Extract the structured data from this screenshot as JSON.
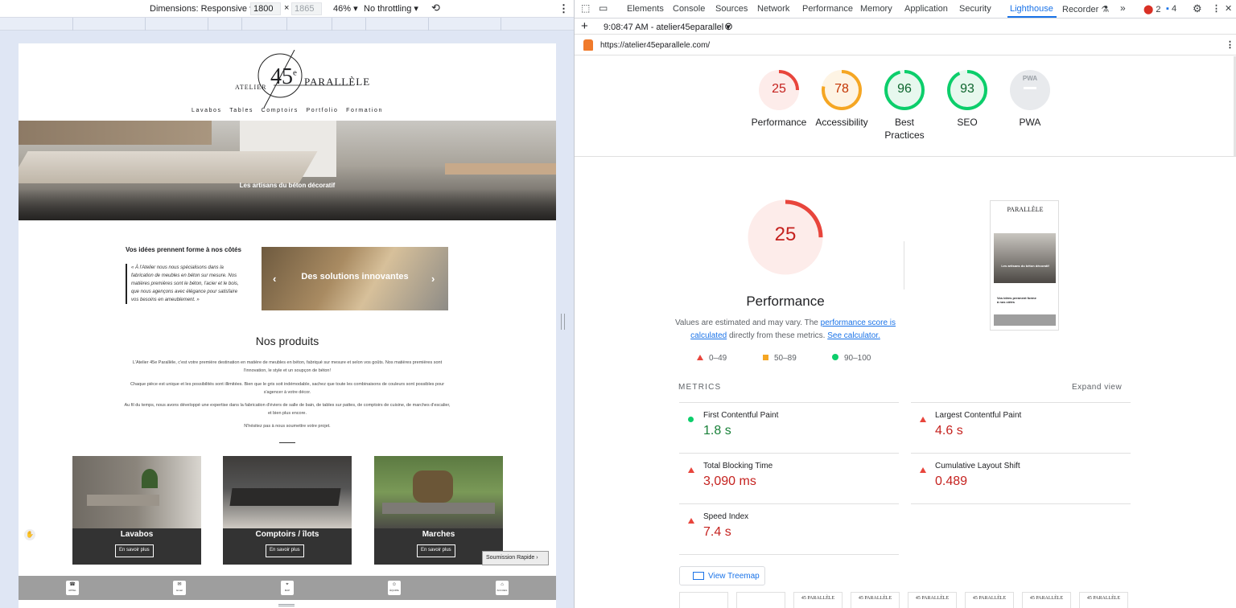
{
  "device_toolbar": {
    "dimensions_label": "Dimensions: Responsive",
    "width": "1800",
    "times": "×",
    "height": "1865",
    "zoom": "46%",
    "throttling": "No throttling"
  },
  "site": {
    "logo": {
      "atelier": "ATELIER",
      "number": "45",
      "sup": "e",
      "parallele": "PARALLÈLE"
    },
    "nav": [
      "Lavabos",
      "Tables",
      "Comptoirs",
      "Portfolio",
      "Formation"
    ],
    "hero_caption": "Les artisans du béton décoratif",
    "idea_heading": "Vos idées prennent forme à nos côtés",
    "idea_quote": "« À l'Atelier nous nous spécialisons dans la fabrication de meubles en béton sur mesure. Nos matières premières sont le béton, l'acier et le bois, que nous agençons avec élégance pour satisfaire vos besoins en ameublement. »",
    "slider_label": "Des solutions innovantes",
    "products_title": "Nos produits",
    "para1": "L'Atelier 45e Parallèle, c'est votre première destination en matière de meubles en béton, fabriqué sur mesure et selon vos goûts. Nos matières premières sont l'innovation, le style et un soupçon de béton!",
    "para2": "Chaque pièce est unique et les possibilités sont illimitées. Bien que le gris soit indémodable, sachez que toute les combinaisons de couleurs sont possibles pour s'agencer à votre décor.",
    "para3": "Au fil du temps, nous avons développé une expertise dans la fabrication d'éviers de salle de bain, de tables sur pattes, de comptoirs de cuisine, de marches d'escalier, et bien plus encore.",
    "para4": "N'hésitez pas à nous soumettre votre projet.",
    "cards": [
      {
        "title": "Lavabos",
        "button": "En savoir plus"
      },
      {
        "title": "Comptoirs / îlots",
        "button": "En savoir plus"
      },
      {
        "title": "Marches",
        "button": "En savoir plus"
      }
    ],
    "quick_submit": "Soumission Rapide",
    "bottom_bar": [
      {
        "icon": "phone-icon",
        "label": "APPEL"
      },
      {
        "icon": "mail-icon",
        "label": "Email"
      },
      {
        "icon": "map-icon",
        "label": "MAP"
      },
      {
        "icon": "team-icon",
        "label": "ÉQUIPE"
      },
      {
        "icon": "home-icon",
        "label": "ACCUEIL"
      }
    ]
  },
  "devtools": {
    "tabs": [
      "Elements",
      "Console",
      "Sources",
      "Network",
      "Performance",
      "Memory",
      "Application",
      "Security",
      "Lighthouse",
      "Recorder"
    ],
    "selected_tab": "Lighthouse",
    "errors": "2",
    "messages": "4",
    "report_selector": "9:08:47 AM - atelier45eparallel",
    "url": "https://atelier45eparallele.com/",
    "scores": [
      {
        "label": "Performance",
        "value": 25,
        "color": "#e8453c"
      },
      {
        "label": "Accessibility",
        "value": 78,
        "color": "#f5a623"
      },
      {
        "label": "Best Practices",
        "value": 96,
        "color": "#0cce6b"
      },
      {
        "label": "SEO",
        "value": 93,
        "color": "#0cce6b"
      },
      {
        "label": "PWA",
        "value": null,
        "color": "#9aa0a6"
      }
    ],
    "big_score": {
      "value": 25,
      "title": "Performance"
    },
    "note_prefix": "Values are estimated and may vary. The ",
    "note_link1": "performance score is calculated",
    "note_mid": " directly from these metrics. ",
    "note_link2": "See calculator.",
    "legend": [
      "0–49",
      "50–89",
      "90–100"
    ],
    "metrics_header": "METRICS",
    "expand_view": "Expand view",
    "metrics": [
      {
        "name": "First Contentful Paint",
        "value": "1.8 s",
        "status": "good"
      },
      {
        "name": "Largest Contentful Paint",
        "value": "4.6 s",
        "status": "poor"
      },
      {
        "name": "Total Blocking Time",
        "value": "3,090 ms",
        "status": "poor"
      },
      {
        "name": "Cumulative Layout Shift",
        "value": "0.489",
        "status": "poor"
      },
      {
        "name": "Speed Index",
        "value": "7.4 s",
        "status": "poor"
      }
    ],
    "treemap": "View Treemap",
    "pwa_badge": "PWA"
  }
}
